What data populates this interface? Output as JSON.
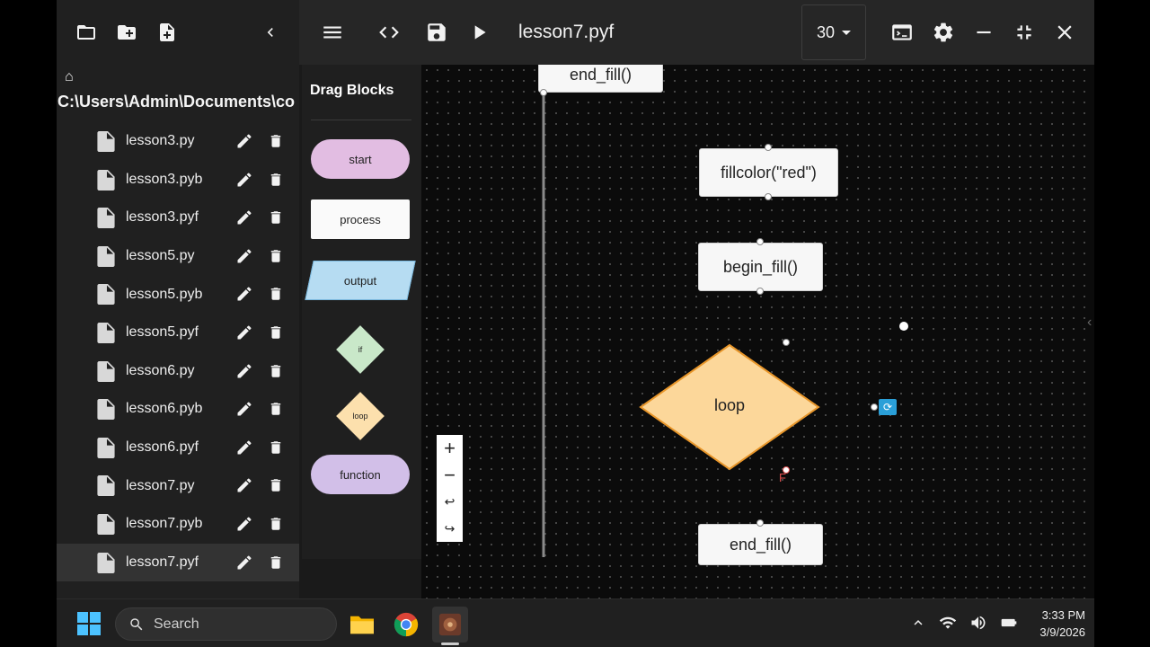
{
  "file_panel": {
    "home_glyph": "⌂",
    "path": "C:\\Users\\Admin\\Documents\\co",
    "files": [
      {
        "name": "lesson3.py"
      },
      {
        "name": "lesson3.pyb"
      },
      {
        "name": "lesson3.pyf"
      },
      {
        "name": "lesson5.py"
      },
      {
        "name": "lesson5.pyb"
      },
      {
        "name": "lesson5.pyf"
      },
      {
        "name": "lesson6.py"
      },
      {
        "name": "lesson6.pyb"
      },
      {
        "name": "lesson6.pyf"
      },
      {
        "name": "lesson7.py"
      },
      {
        "name": "lesson7.pyb"
      },
      {
        "name": "lesson7.pyf"
      }
    ],
    "selected_file": "lesson7.pyf"
  },
  "top_bar": {
    "file_title": "lesson7.pyf",
    "speed_value": "30"
  },
  "palette": {
    "title": "Drag Blocks",
    "blocks": {
      "start": "start",
      "process": "process",
      "output": "output",
      "if": "if",
      "loop": "loop",
      "function": "function"
    }
  },
  "canvas": {
    "nodes": {
      "end_fill_top": "end_fill()",
      "fillcolor": "fillcolor(\"red\")",
      "begin_fill": "begin_fill()",
      "loop": "loop",
      "loop_false_label": "F",
      "end_fill_bottom": "end_fill()"
    },
    "zoom": {
      "zoom_in": "+",
      "zoom_out": "−",
      "undo": "↩",
      "redo": "↪"
    }
  },
  "taskbar": {
    "search_placeholder": "Search",
    "time": "3:33 PM",
    "date": "3/9/2026"
  },
  "colors": {
    "accent_loop": "#fcd79a",
    "loop_border": "#e8962a",
    "loop_port": "#2a9fd8"
  }
}
